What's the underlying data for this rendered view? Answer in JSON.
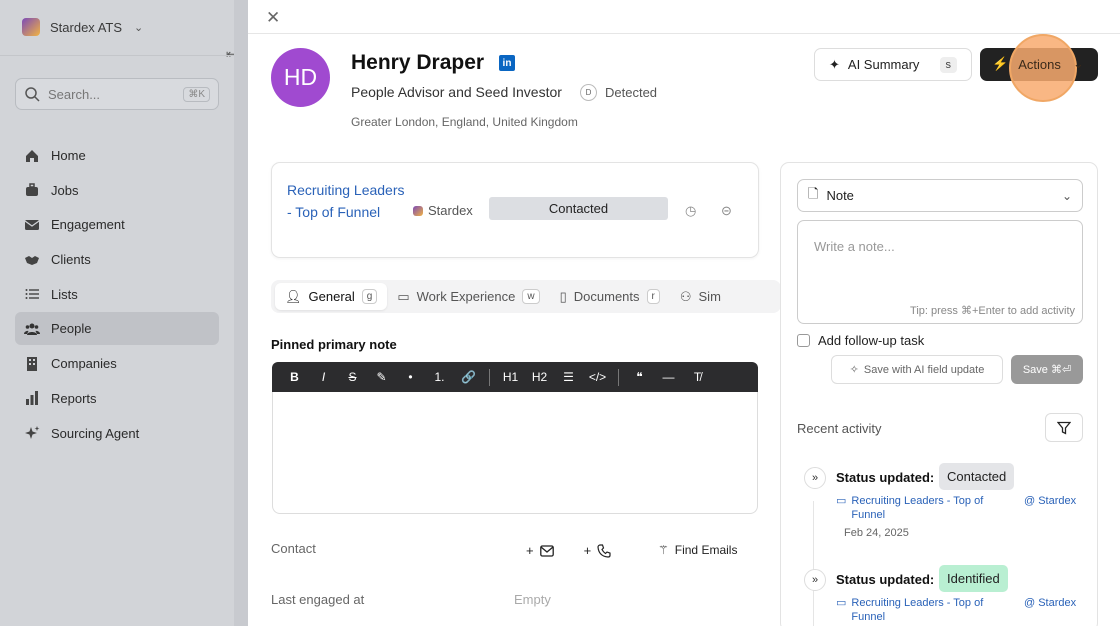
{
  "sidebar": {
    "workspace": "Stardex ATS",
    "search_placeholder": "Search...",
    "search_shortcut": "⌘K",
    "items": [
      {
        "label": "Home",
        "icon": "home-icon"
      },
      {
        "label": "Jobs",
        "icon": "briefcase-icon"
      },
      {
        "label": "Engagement",
        "icon": "mail-icon"
      },
      {
        "label": "Clients",
        "icon": "handshake-icon"
      },
      {
        "label": "Lists",
        "icon": "list-icon"
      },
      {
        "label": "People",
        "icon": "people-icon",
        "active": true
      },
      {
        "label": "Companies",
        "icon": "building-icon"
      },
      {
        "label": "Reports",
        "icon": "bar-chart-icon"
      },
      {
        "label": "Sourcing Agent",
        "icon": "sparkle-icon"
      }
    ]
  },
  "profile": {
    "initials": "HD",
    "name": "Henry Draper",
    "headline": "People Advisor and Seed Investor",
    "badge": "D",
    "detected": "Detected",
    "location": "Greater London, England, United Kingdom"
  },
  "header_actions": {
    "ai_summary_label": "AI Summary",
    "ai_summary_shortcut": "s",
    "actions_label": "Actions"
  },
  "pipeline": {
    "job": "Recruiting Leaders - Top of Funnel",
    "org": "Stardex",
    "status": "Contacted"
  },
  "tabs": [
    {
      "label": "General",
      "shortcut": "g",
      "active": true
    },
    {
      "label": "Work Experience",
      "shortcut": "w"
    },
    {
      "label": "Documents",
      "shortcut": "r"
    },
    {
      "label": "Sim"
    }
  ],
  "pinned_note_label": "Pinned primary note",
  "toolbar": [
    "B",
    "I",
    "S",
    "✎",
    "•",
    "1.",
    "🔗",
    "H1",
    "H2",
    "☰",
    "</>",
    "❝",
    "—",
    "T̸"
  ],
  "contact": {
    "label": "Contact",
    "find_emails": "Find Emails"
  },
  "last_engaged": {
    "label": "Last engaged at",
    "value": "Empty"
  },
  "note_panel": {
    "type": "Note",
    "placeholder": "Write a note...",
    "tip": "Tip: press ⌘+Enter to add activity",
    "followup": "Add follow-up task",
    "save_ai": "Save with AI field update",
    "save": "Save ⌘⏎",
    "recent": "Recent activity"
  },
  "activity": [
    {
      "title": "Status updated:",
      "status": "Contacted",
      "status_color": "#e4e5e8",
      "job": "Recruiting Leaders - Top of Funnel",
      "org": "@ Stardex",
      "date": "Feb 24, 2025"
    },
    {
      "title": "Status updated:",
      "status": "Identified",
      "status_color": "#b9efd2",
      "job": "Recruiting Leaders - Top of Funnel",
      "org": "@ Stardex",
      "date": ""
    }
  ]
}
